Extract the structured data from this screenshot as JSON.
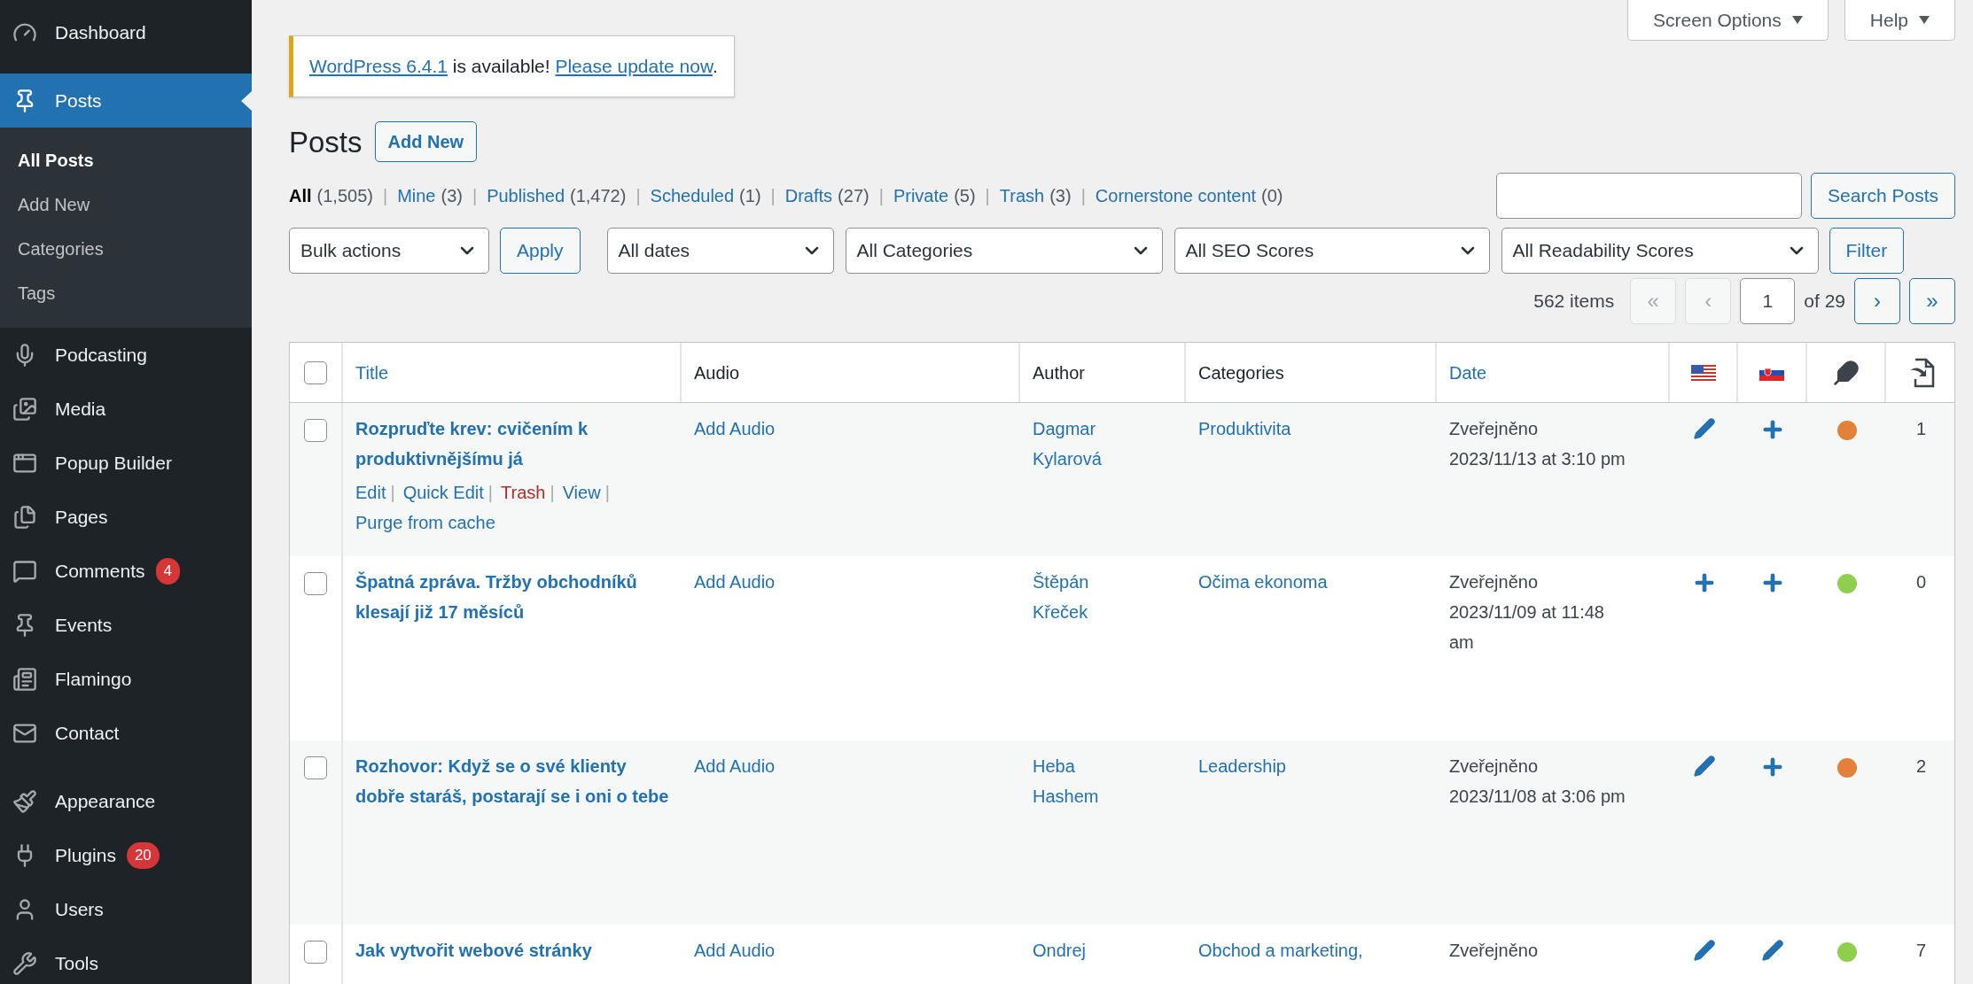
{
  "sidebar": {
    "groups": [
      [
        {
          "label": "Dashboard",
          "selected": false
        }
      ],
      [
        {
          "label": "Posts",
          "selected": true,
          "children": [
            {
              "label": "All Posts",
              "selected": true
            },
            {
              "label": "Add New",
              "selected": false
            },
            {
              "label": "Categories",
              "selected": false
            },
            {
              "label": "Tags",
              "selected": false
            }
          ]
        },
        {
          "label": "Podcasting",
          "selected": false
        },
        {
          "label": "Media",
          "selected": false
        },
        {
          "label": "Popup Builder",
          "selected": false
        },
        {
          "label": "Pages",
          "selected": false
        },
        {
          "label": "Comments",
          "selected": false,
          "badge": "4"
        },
        {
          "label": "Events",
          "selected": false
        },
        {
          "label": "Flamingo",
          "selected": false
        },
        {
          "label": "Contact",
          "selected": false
        }
      ],
      [
        {
          "label": "Appearance",
          "selected": false
        },
        {
          "label": "Plugins",
          "selected": false,
          "badge": "20"
        },
        {
          "label": "Users",
          "selected": false
        },
        {
          "label": "Tools",
          "selected": false
        }
      ]
    ]
  },
  "top_buttons": [
    "Screen Options",
    "Help"
  ],
  "notice": [
    {
      "text": "WordPress 6.4.1",
      "link": true
    },
    {
      "text": " is available! ",
      "link": false
    },
    {
      "text": "Please update now",
      "link": true
    },
    {
      "text": ".",
      "link": false
    }
  ],
  "heading": "Posts",
  "add_new": "Add New",
  "views": [
    {
      "label": "All",
      "count": "(1,505)",
      "selected": true
    },
    {
      "separator": "|",
      "label": "Mine",
      "count": "(3)",
      "selected": false
    },
    {
      "separator": "|",
      "label": "Published",
      "count": "(1,472)",
      "selected": false
    },
    {
      "separator": "|",
      "label": "Scheduled",
      "count": "(1)",
      "selected": false
    },
    {
      "separator": "|",
      "label": "Drafts",
      "count": "(27)",
      "selected": false
    },
    {
      "separator": "|",
      "label": "Private",
      "count": "(5)",
      "selected": false
    },
    {
      "separator": "|",
      "label": "Trash",
      "count": "(3)",
      "selected": false
    },
    {
      "separator": "|",
      "label": "Cornerstone content",
      "count": "(0)",
      "selected": false
    }
  ],
  "select_all": {
    "checked": false
  },
  "search_button": "Search Posts",
  "bulk": {
    "select": "Bulk actions",
    "button": "Apply"
  },
  "filters": [
    "All dates",
    "All Categories",
    "All SEO Scores",
    "All Readability Scores"
  ],
  "filter_button": "Filter",
  "pagination": {
    "items": "562 items",
    "first": {
      "label": "«",
      "disabled": true
    },
    "prev": {
      "label": "‹",
      "disabled": true
    },
    "page": "1",
    "of": "of 29",
    "next": {
      "label": "›",
      "disabled": false
    },
    "last": {
      "label": "»",
      "disabled": false
    }
  },
  "columns": [
    {
      "label": "Title",
      "sortable": true
    },
    {
      "label": "Audio",
      "sortable": false
    },
    {
      "label": "Author",
      "sortable": false
    },
    {
      "label": "Categories",
      "sortable": false
    },
    {
      "label": "Date",
      "sortable": true
    }
  ],
  "rows": [
    {
      "checked": false,
      "title": "Rozpruďte krev: cvičením k produktivnějšímu já",
      "row_actions": [
        {
          "label": "Edit",
          "kind": "link",
          "separator": "|"
        },
        {
          "label": "Quick Edit",
          "kind": "link",
          "separator": "|"
        },
        {
          "label": "Trash",
          "kind": "delete",
          "separator": "|"
        },
        {
          "label": "View",
          "kind": "link",
          "separator": "|"
        },
        {
          "label": "Purge from cache",
          "kind": "link"
        }
      ],
      "audio": "Add Audio",
      "author": "Dagmar Kylarová",
      "categories": "Produktivita",
      "status": "Zveřejněno",
      "date": "2023/11/13 at 3:10 pm",
      "translations": [
        {
          "kind": "edit"
        },
        {
          "kind": "add"
        }
      ],
      "seo_score": {
        "color": "#e2813a"
      },
      "links": "1"
    },
    {
      "checked": false,
      "title": "Špatná zpráva. Tržby obchodníků klesají již 17 měsíců",
      "audio": "Add Audio",
      "author": "Štěpán Křeček",
      "categories": "Očima ekonoma",
      "status": "Zveřejněno",
      "date": "2023/11/09 at 11:48 am",
      "translations": [
        {
          "kind": "add"
        },
        {
          "kind": "add"
        }
      ],
      "seo_score": {
        "color": "#8ecf4e"
      },
      "links": "0"
    },
    {
      "checked": false,
      "title": "Rozhovor: Když se o své klienty dobře staráš, postarají se i oni o tebe",
      "audio": "Add Audio",
      "author": "Heba Hashem",
      "categories": "Leadership",
      "status": "Zveřejněno",
      "date": "2023/11/08 at 3:06 pm",
      "translations": [
        {
          "kind": "edit"
        },
        {
          "kind": "add"
        }
      ],
      "seo_score": {
        "color": "#e2813a"
      },
      "links": "2"
    },
    {
      "checked": false,
      "title": "Jak vytvořit webové stránky",
      "audio": "Add Audio",
      "author": "Ondrej",
      "categories": "Obchod a marketing,",
      "status": "Zveřejněno",
      "translations": [
        {
          "kind": "edit"
        },
        {
          "kind": "edit"
        }
      ],
      "seo_score": {
        "color": "#8ecf4e"
      },
      "links": "7"
    }
  ]
}
